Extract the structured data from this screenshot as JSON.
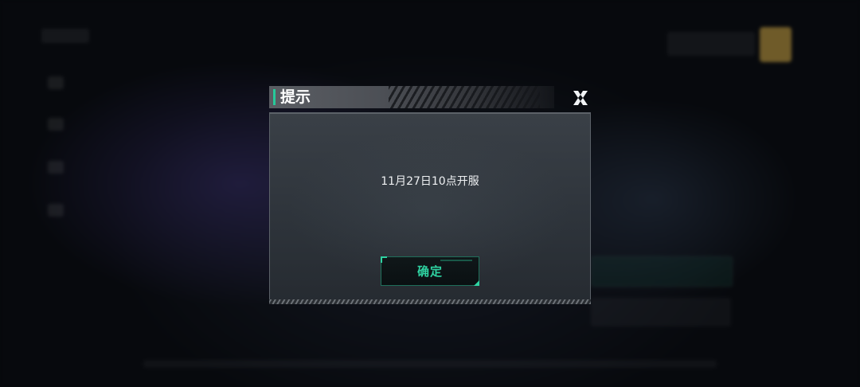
{
  "dialog": {
    "title": "提示",
    "message": "11月27日10点开服",
    "confirm_label": "确定",
    "close_icon": "close-x-icon"
  },
  "colors": {
    "accent": "#2fd3a2",
    "panel": "#2e343b",
    "title_bar": "#4c4f55"
  }
}
